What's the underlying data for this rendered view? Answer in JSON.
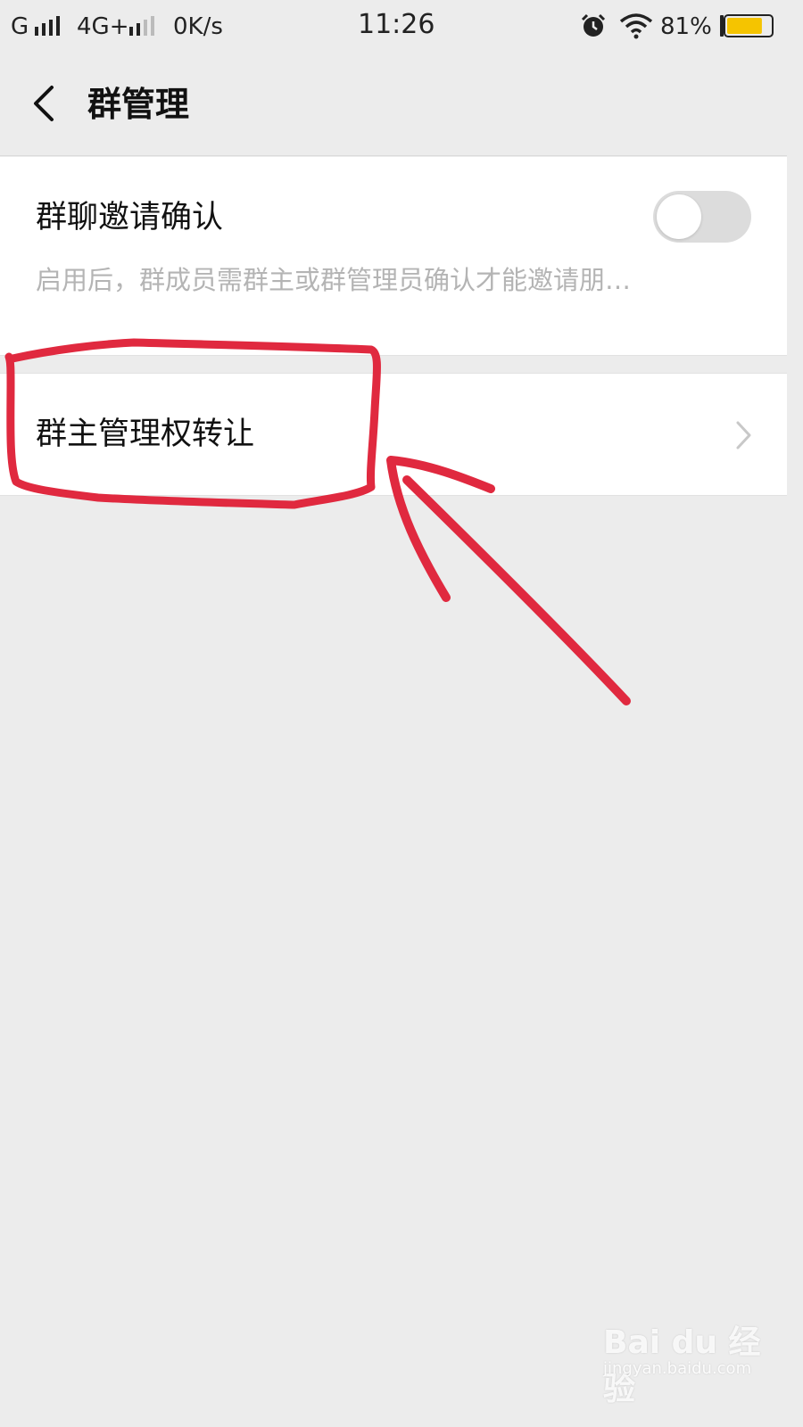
{
  "status_bar": {
    "network1": "G",
    "network2": "4G+",
    "speed": "0K/s",
    "time": "11:26",
    "battery": "81%",
    "battery_level": 0.81,
    "icons": [
      "signal-icon",
      "signal-icon",
      "alarm-icon",
      "wifi-icon",
      "battery-icon"
    ]
  },
  "header": {
    "title": "群管理",
    "back_icon": "chevron-left-icon"
  },
  "settings": {
    "invite_confirm": {
      "label": "群聊邀请确认",
      "description": "启用后，群成员需群主或群管理员确认才能邀请朋…",
      "toggle_on": false
    },
    "transfer_owner": {
      "label": "群主管理权转让",
      "chevron_icon": "chevron-right-icon"
    }
  },
  "annotation": {
    "color": "#e0293f"
  },
  "watermark": {
    "logo_text": "Bai du 经验",
    "url": "jingyan.baidu.com"
  },
  "colors": {
    "background": "#ececec",
    "card": "#ffffff",
    "secondary_text": "#b4b4b4",
    "toggle_off": "#dcdcdc",
    "battery_fill": "#f5c400"
  }
}
